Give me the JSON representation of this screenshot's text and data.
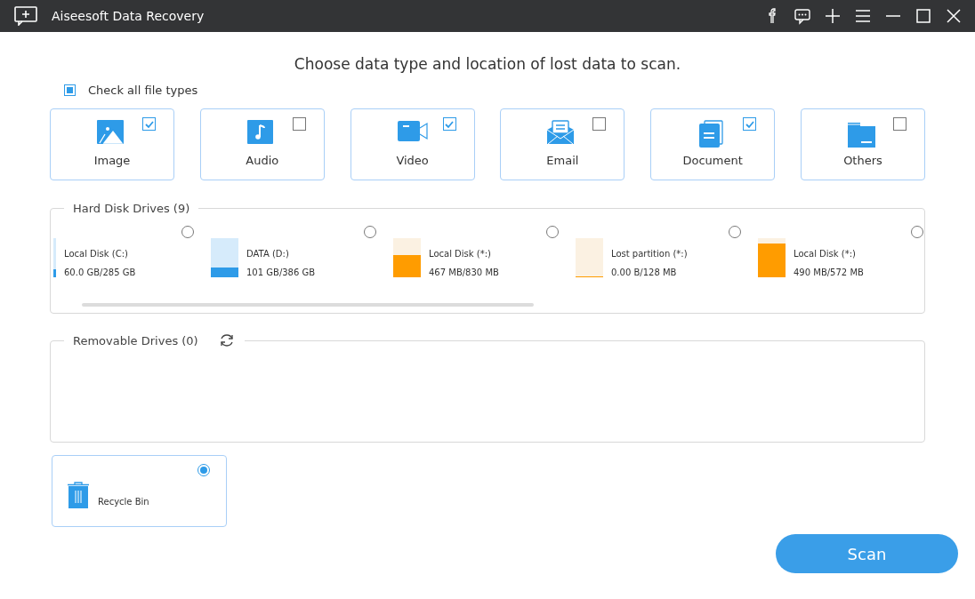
{
  "window": {
    "title": "Aiseesoft Data Recovery"
  },
  "heading": "Choose data type and location of lost data to scan.",
  "check_all": {
    "label": "Check all file types",
    "checked": false,
    "indeterminate": true
  },
  "file_types": [
    {
      "label": "Image",
      "kind": "image",
      "checked": true
    },
    {
      "label": "Audio",
      "kind": "audio",
      "checked": false
    },
    {
      "label": "Video",
      "kind": "video",
      "checked": true
    },
    {
      "label": "Email",
      "kind": "email",
      "checked": false
    },
    {
      "label": "Document",
      "kind": "document",
      "checked": true
    },
    {
      "label": "Others",
      "kind": "others",
      "checked": false
    }
  ],
  "hard_disk_drives": {
    "title": "Hard Disk Drives (9)",
    "drives": [
      {
        "name": "Local Disk (C:)",
        "usage": "60.0 GB/285 GB",
        "level": 0.21,
        "color": "#2e9be8",
        "selected": false
      },
      {
        "name": "DATA (D:)",
        "usage": "101 GB/386 GB",
        "level": 0.26,
        "color": "#2e9be8",
        "selected": false
      },
      {
        "name": "Local Disk (*:)",
        "usage": "467 MB/830 MB",
        "level": 0.56,
        "color": "#ff9c00",
        "selected": false
      },
      {
        "name": "Lost partition (*:)",
        "usage": "0.00  B/128 MB",
        "level": 0.03,
        "color": "#ff9c00",
        "selected": false
      },
      {
        "name": "Local Disk (*:)",
        "usage": "490 MB/572 MB",
        "level": 0.86,
        "color": "#ff9c00",
        "selected": false
      }
    ]
  },
  "removable_drives": {
    "title": "Removable Drives (0)"
  },
  "recycle_bin": {
    "label": "Recycle Bin",
    "selected": true
  },
  "scan_button": "Scan"
}
